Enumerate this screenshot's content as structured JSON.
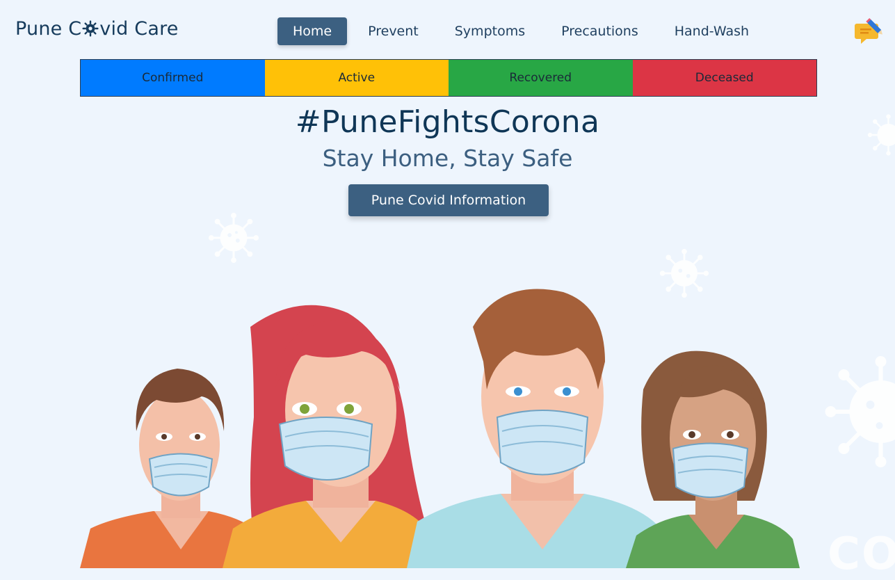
{
  "brand": {
    "name_prefix": "Pune C",
    "name_suffix": "vid Care"
  },
  "nav": {
    "items": [
      {
        "label": "Home"
      },
      {
        "label": "Prevent"
      },
      {
        "label": "Symptoms"
      },
      {
        "label": "Precautions"
      },
      {
        "label": "Hand-Wash"
      }
    ],
    "active": "Home"
  },
  "stats": [
    {
      "label": "Confirmed",
      "color": "#007bff"
    },
    {
      "label": "Active",
      "color": "#ffc107"
    },
    {
      "label": "Recovered",
      "color": "#28a745"
    },
    {
      "label": "Deceased",
      "color": "#dc3545"
    }
  ],
  "hero": {
    "hashtag": "#PuneFightsCorona",
    "tagline": "Stay Home, Stay Safe",
    "cta_label": "Pune Covid Information",
    "watermark": "COV"
  },
  "icons": {
    "corner": "feedback-pencil-icon",
    "brand_logo": "virus-gear-icon"
  },
  "colors": {
    "primary": "#3c6081",
    "background": "#eef5fd",
    "heading": "#0f3656"
  }
}
